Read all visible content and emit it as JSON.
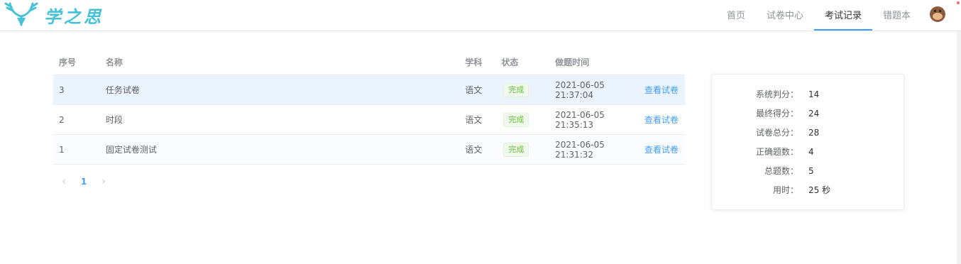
{
  "header": {
    "logo_text": "学之思",
    "nav": [
      {
        "label": "首页",
        "active": false
      },
      {
        "label": "试卷中心",
        "active": false
      },
      {
        "label": "考试记录",
        "active": true
      },
      {
        "label": "错题本",
        "active": false
      }
    ]
  },
  "table": {
    "columns": [
      "序号",
      "名称",
      "学科",
      "状态",
      "做题时间",
      ""
    ],
    "rows": [
      {
        "no": "3",
        "name": "任务试卷",
        "subject": "语文",
        "status": "完成",
        "time": "2021-06-05 21:37:04",
        "action": "查看试卷"
      },
      {
        "no": "2",
        "name": "时段",
        "subject": "语文",
        "status": "完成",
        "time": "2021-06-05 21:35:13",
        "action": "查看试卷"
      },
      {
        "no": "1",
        "name": "固定试卷测试",
        "subject": "语文",
        "status": "完成",
        "time": "2021-06-05 21:31:32",
        "action": "查看试卷"
      }
    ]
  },
  "pagination": {
    "current": "1",
    "prev_icon": "chevron-left-icon",
    "next_icon": "chevron-right-icon"
  },
  "stats": [
    {
      "label": "系统判分：",
      "value": "14"
    },
    {
      "label": "最终得分：",
      "value": "24"
    },
    {
      "label": "试卷总分：",
      "value": "28"
    },
    {
      "label": "正确题数：",
      "value": "4"
    },
    {
      "label": "总题数：",
      "value": "5"
    },
    {
      "label": "用时：",
      "value": "25 秒"
    }
  ],
  "colors": {
    "accent": "#409eff",
    "logo": "#45c1d8",
    "success": "#67c23a"
  }
}
